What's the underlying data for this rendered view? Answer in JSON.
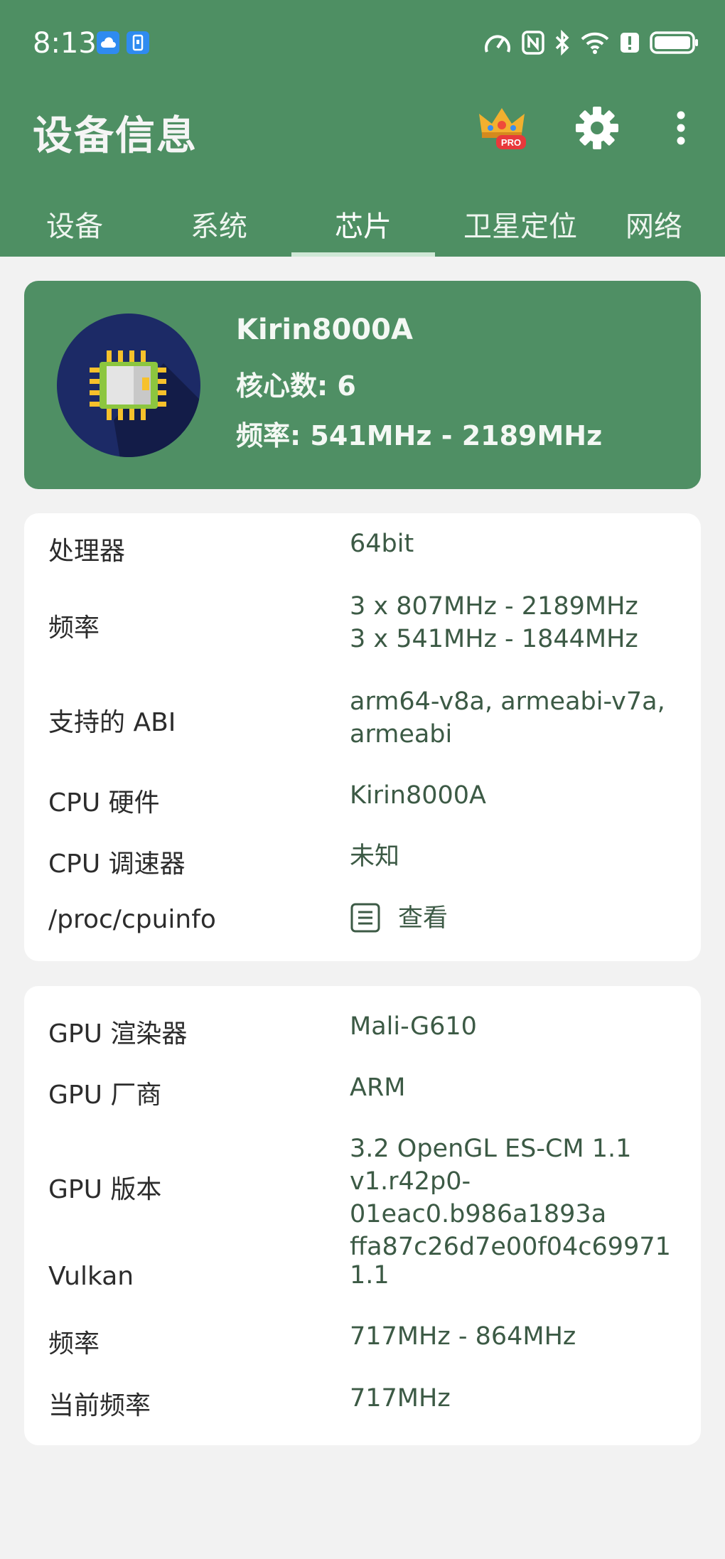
{
  "status_bar": {
    "time": "8:13"
  },
  "header": {
    "title": "设备信息",
    "icons": [
      "crown-pro-icon",
      "gear-icon",
      "more-vert-icon"
    ],
    "pro_badge": "PRO"
  },
  "tabs": [
    "设备",
    "系统",
    "芯片",
    "卫星定位",
    "网络"
  ],
  "active_tab": "芯片",
  "hero": {
    "chip_name": "Kirin8000A",
    "cores": "核心数: 6",
    "frequency": "频率: 541MHz - 2189MHz"
  },
  "cpu_card": {
    "rows": [
      {
        "label": "处理器",
        "value": [
          "64bit"
        ]
      },
      {
        "label": "频率",
        "value": [
          "3 x 807MHz - 2189MHz",
          "3 x 541MHz - 1844MHz"
        ]
      },
      {
        "label": "支持的 ABI",
        "value": [
          "arm64-v8a, armeabi-v7a,",
          "armeabi"
        ]
      },
      {
        "label": "CPU 硬件",
        "value": [
          "Kirin8000A"
        ]
      },
      {
        "label": "CPU 调速器",
        "value": [
          "未知"
        ]
      },
      {
        "label": "/proc/cpuinfo",
        "value": [
          "查看"
        ]
      }
    ]
  },
  "gpu_card": {
    "rows": [
      {
        "label": "GPU 渲染器",
        "value": [
          "Mali-G610"
        ]
      },
      {
        "label": "GPU 厂商",
        "value": [
          "ARM"
        ]
      },
      {
        "label": "GPU 版本",
        "value": [
          "3.2 OpenGL ES-CM 1.1",
          "v1.r42p0-01eac0.b986a1893a",
          "ffa87c26d7e00f04c69971"
        ]
      },
      {
        "label": "Vulkan",
        "value": [
          "1.1"
        ]
      },
      {
        "label": "频率",
        "value": [
          "717MHz - 864MHz"
        ]
      },
      {
        "label": "当前频率",
        "value": [
          "717MHz"
        ]
      }
    ]
  },
  "colors": {
    "primary": "#4e8f63",
    "value_text": "#3c5a45",
    "background": "#f2f2f2"
  }
}
